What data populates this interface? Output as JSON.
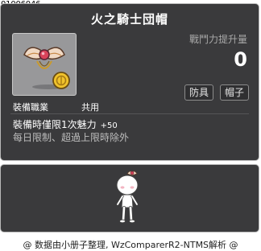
{
  "item": {
    "id": "01006046",
    "name": "火之騎士団帽",
    "icon": "winged-emblem-hat-icon"
  },
  "stats": {
    "gain_label": "戰鬥力提升量",
    "gain_value": "0"
  },
  "tags": [
    "防具",
    "帽子"
  ],
  "job": {
    "label": "裝備職業",
    "value": "共用"
  },
  "effect": {
    "text": "裝備時僅限1次魅力",
    "value": "+50"
  },
  "notice": "每日限制、超過上限時除外",
  "preview": {
    "avatar": "character-avatar-icon"
  },
  "credit": "@ 数据由小册子整理, WzComparerR2-NTMS解析 @"
}
